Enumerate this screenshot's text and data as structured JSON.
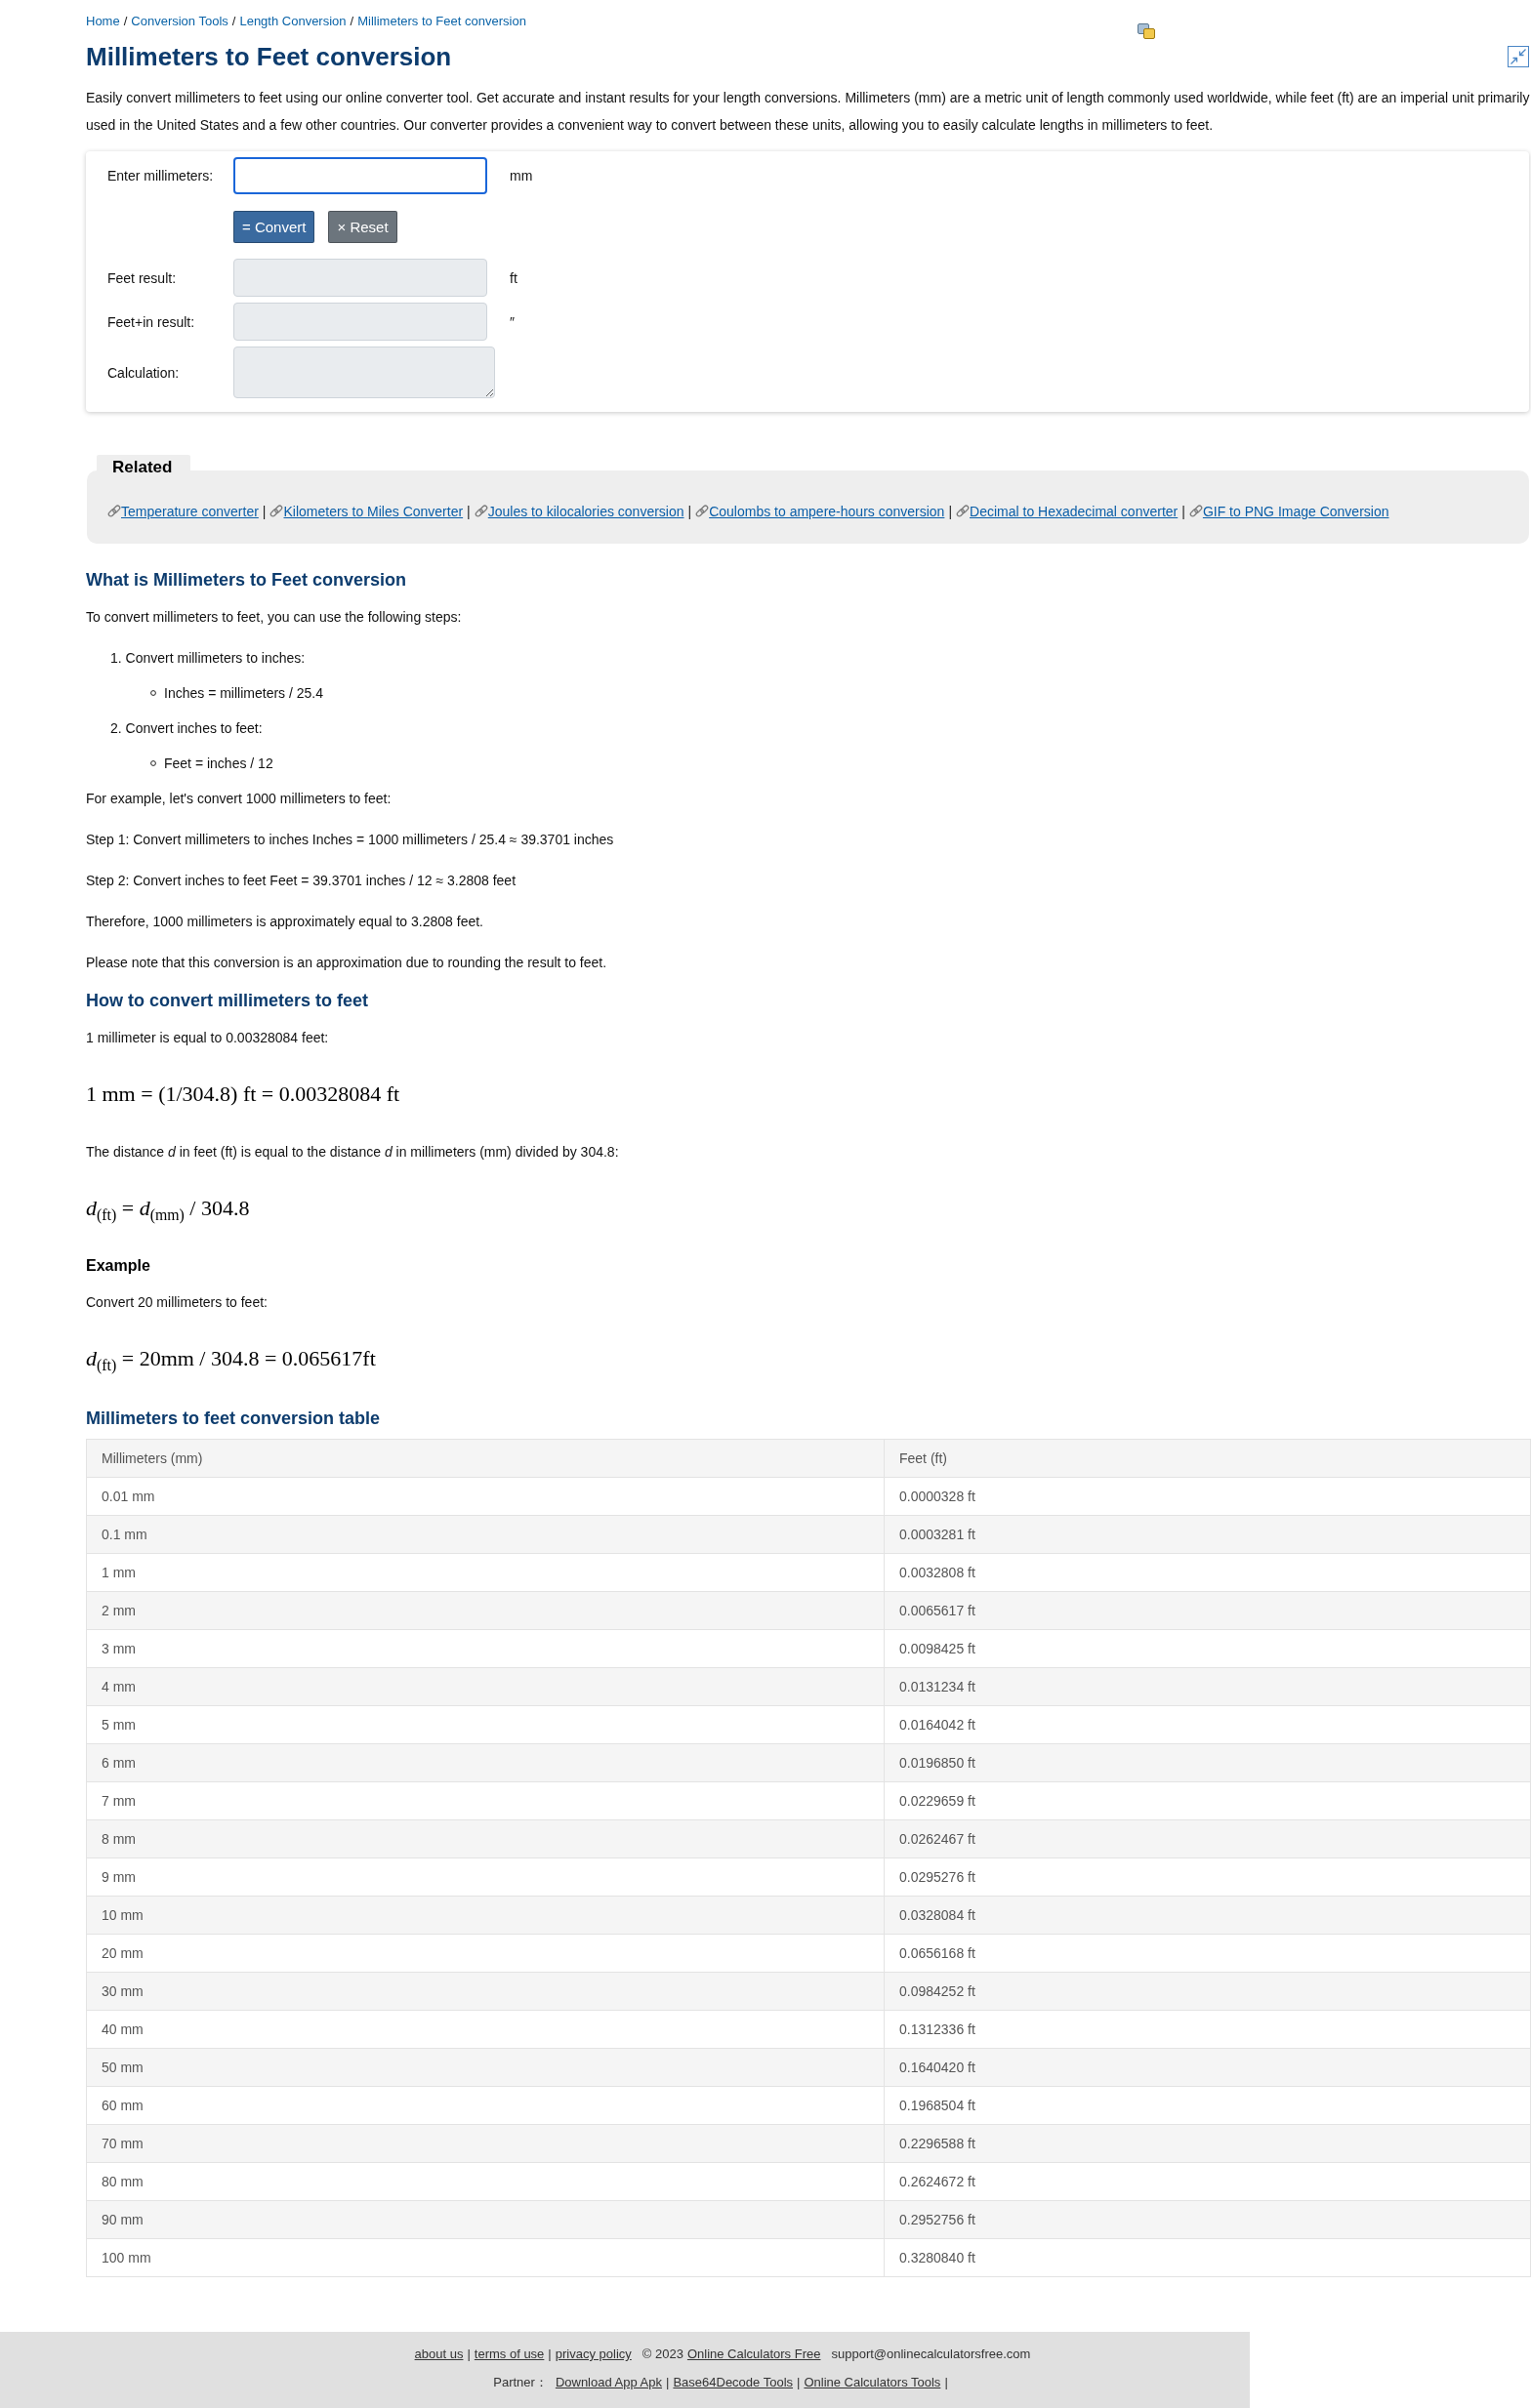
{
  "breadcrumb": {
    "items": [
      "Home",
      "Conversion Tools",
      "Length Conversion",
      "Millimeters to Feet conversion"
    ],
    "separator": "/"
  },
  "title": "Millimeters to Feet conversion",
  "intro": "Easily convert millimeters to feet using our online converter tool. Get accurate and instant results for your length conversions. Millimeters (mm) are a metric unit of length commonly used worldwide, while feet (ft) are an imperial unit primarily used in the United States and a few other countries. Our converter provides a convenient way to convert between these units, allowing you to easily calculate lengths in millimeters to feet.",
  "converter": {
    "input": {
      "label": "Enter millimeters:",
      "kind": "text",
      "unit": "mm",
      "focused": true,
      "readonly": false
    },
    "buttons": [
      {
        "label": "= Convert",
        "kind": "primary"
      },
      {
        "label": "× Reset",
        "kind": "secondary"
      }
    ],
    "results": [
      {
        "label": "Feet result:",
        "kind": "text",
        "unit": "ft",
        "focused": false,
        "readonly": true
      },
      {
        "label": "Feet+in result:",
        "kind": "text",
        "unit": "″",
        "focused": false,
        "readonly": true
      },
      {
        "label": "Calculation:",
        "kind": "textarea",
        "focused": false,
        "readonly": true
      }
    ]
  },
  "related": {
    "heading": "Related",
    "separator": "|",
    "links": [
      "Temperature converter",
      "Kilometers to Miles Converter",
      "Joules to kilocalories conversion",
      "Coulombs to ampere-hours conversion",
      "Decimal to Hexadecimal converter",
      "GIF to PNG Image Conversion"
    ]
  },
  "article": {
    "blocks": [
      {
        "kind": "heading",
        "text": "What is Millimeters to Feet conversion"
      },
      {
        "kind": "paragraph",
        "text": "To convert millimeters to feet, you can use the following steps:"
      },
      {
        "kind": "list",
        "items": [
          {
            "number": "1.",
            "text": "Convert millimeters to inches:",
            "children": [
              {
                "text": "Inches = millimeters / 25.4"
              }
            ]
          },
          {
            "number": "2.",
            "text": "Convert inches to feet:",
            "children": [
              {
                "text": "Feet = inches / 12"
              }
            ]
          }
        ]
      },
      {
        "kind": "paragraph",
        "text": "For example, let's convert 1000 millimeters to feet:"
      },
      {
        "kind": "paragraph",
        "text": "Step 1: Convert millimeters to inches Inches = 1000 millimeters / 25.4 ≈ 39.3701 inches"
      },
      {
        "kind": "paragraph",
        "text": "Step 2: Convert inches to feet Feet = 39.3701 inches / 12 ≈ 3.2808 feet"
      },
      {
        "kind": "paragraph",
        "text": "Therefore, 1000 millimeters is approximately equal to 3.2808 feet."
      },
      {
        "kind": "paragraph",
        "text": "Please note that this conversion is an approximation due to rounding the result to feet."
      },
      {
        "kind": "heading",
        "text": "How to convert millimeters to feet"
      },
      {
        "kind": "paragraph",
        "text": "1 millimeter is equal to 0.00328084 feet:"
      },
      {
        "kind": "formula",
        "text": "1 mm = (1/304.8) ft = 0.00328084 ft"
      },
      {
        "kind": "paragraph",
        "text": "The distance *d* in feet (ft) is equal to the distance *d* in millimeters (mm) divided by 304.8:"
      },
      {
        "kind": "formula",
        "text": "*d*$_{(ft)}$ = *d*$_{(mm)}$ / 304.8"
      },
      {
        "kind": "subheading",
        "text": "Example"
      },
      {
        "kind": "paragraph",
        "text": "Convert 20 millimeters to feet:"
      },
      {
        "kind": "formula",
        "text": "*d*$_{(ft)}$ = 20mm / 304.8 = 0.065617ft"
      }
    ]
  },
  "table": {
    "title": "Millimeters to feet conversion table",
    "columns": [
      "Millimeters (mm)",
      "Feet (ft)"
    ],
    "rows": [
      [
        "0.01 mm",
        "0.0000328 ft"
      ],
      [
        "0.1 mm",
        "0.0003281 ft"
      ],
      [
        "1 mm",
        "0.0032808 ft"
      ],
      [
        "2 mm",
        "0.0065617 ft"
      ],
      [
        "3 mm",
        "0.0098425 ft"
      ],
      [
        "4 mm",
        "0.0131234 ft"
      ],
      [
        "5 mm",
        "0.0164042 ft"
      ],
      [
        "6 mm",
        "0.0196850 ft"
      ],
      [
        "7 mm",
        "0.0229659 ft"
      ],
      [
        "8 mm",
        "0.0262467 ft"
      ],
      [
        "9 mm",
        "0.0295276 ft"
      ],
      [
        "10 mm",
        "0.0328084 ft"
      ],
      [
        "20 mm",
        "0.0656168 ft"
      ],
      [
        "30 mm",
        "0.0984252 ft"
      ],
      [
        "40 mm",
        "0.1312336 ft"
      ],
      [
        "50 mm",
        "0.1640420 ft"
      ],
      [
        "60 mm",
        "0.1968504 ft"
      ],
      [
        "70 mm",
        "0.2296588 ft"
      ],
      [
        "80 mm",
        "0.2624672 ft"
      ],
      [
        "90 mm",
        "0.2952756 ft"
      ],
      [
        "100 mm",
        "0.3280840 ft"
      ]
    ]
  },
  "footer": {
    "links": [
      "about us",
      "terms of use",
      "privacy policy"
    ],
    "separator": "|",
    "copyright": "© 2023",
    "site_link": "Online Calculators Free",
    "email": "support@onlinecalculatorsfree.com",
    "partner": {
      "label": "Partner：",
      "links": [
        "Download App Apk",
        "Base64Decode Tools",
        "Online Calculators Tools"
      ],
      "separator": "|"
    }
  }
}
